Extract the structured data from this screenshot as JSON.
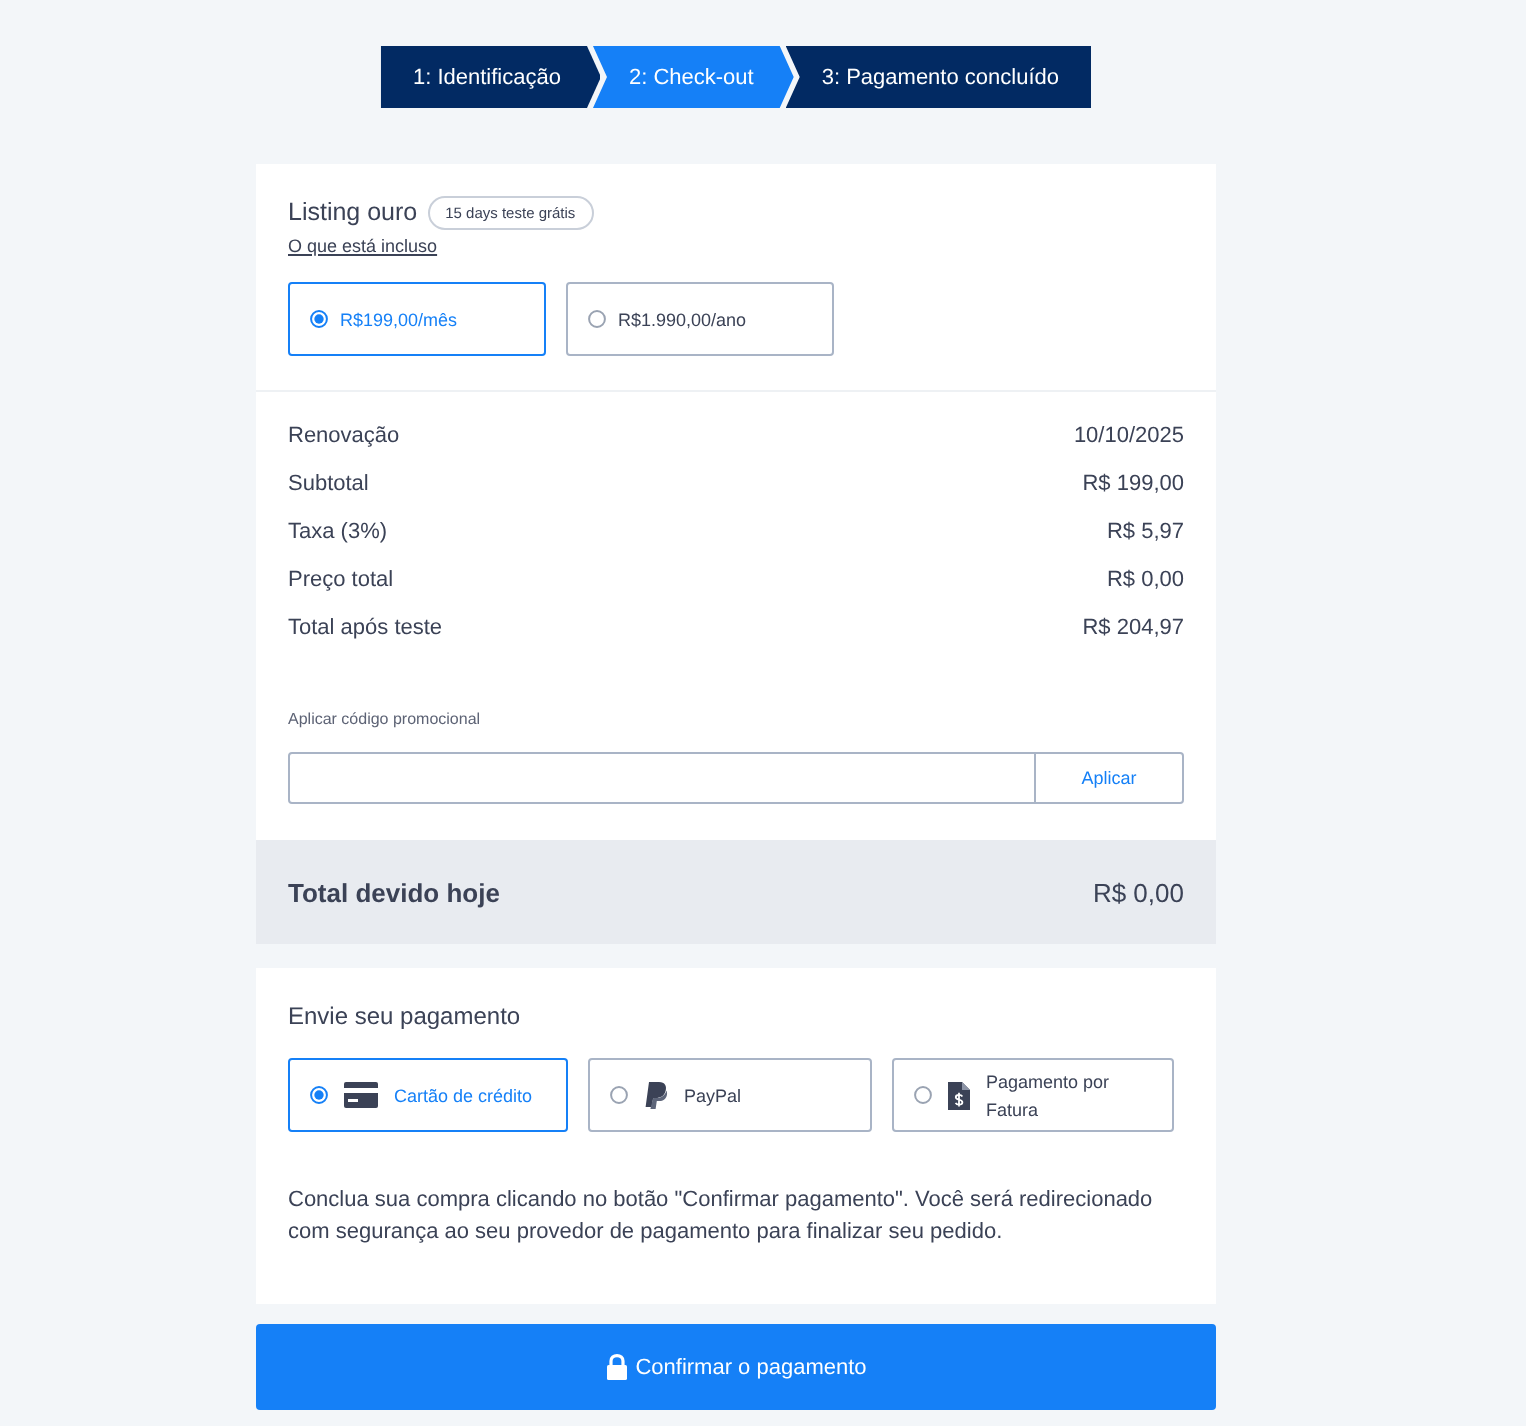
{
  "steps": [
    {
      "label": "1: Identificação",
      "selected": false
    },
    {
      "label": "2: Check-out",
      "selected": true
    },
    {
      "label": "3: Pagamento concluído",
      "selected": false
    }
  ],
  "plan": {
    "title": "Listing ouro",
    "badge": "15 days teste grátis",
    "link": "O que está incluso",
    "options": [
      {
        "label": "R$199,00/mês",
        "selected": true
      },
      {
        "label": "R$1.990,00/ano",
        "selected": false
      }
    ]
  },
  "summary": {
    "rows": [
      {
        "label": "Renovação",
        "value": "10/10/2025"
      },
      {
        "label": "Subtotal",
        "value": "R$ 199,00"
      },
      {
        "label": "Taxa (3%)",
        "value": "R$ 5,97"
      },
      {
        "label": "Preço total",
        "value": "R$ 0,00"
      },
      {
        "label": "Total após teste",
        "value": "R$ 204,97"
      }
    ]
  },
  "promo": {
    "label": "Aplicar código promocional",
    "button": "Aplicar"
  },
  "total": {
    "label": "Total devido hoje",
    "value": "R$ 0,00"
  },
  "payment": {
    "title": "Envie seu pagamento",
    "methods": [
      {
        "kind": "card",
        "label": "Cartão de crédito",
        "selected": true
      },
      {
        "kind": "paypal",
        "label": "PayPal",
        "selected": false
      },
      {
        "kind": "invoice",
        "label": "Pagamento por Fatura",
        "selected": false
      }
    ],
    "note": "Conclua sua compra clicando no botão \"Confirmar pagamento\". Você será redirecionado com segurança ao seu provedor de pagamento para finalizar seu pedido."
  },
  "confirm_button": {
    "label": "Confirmar o pagamento"
  }
}
